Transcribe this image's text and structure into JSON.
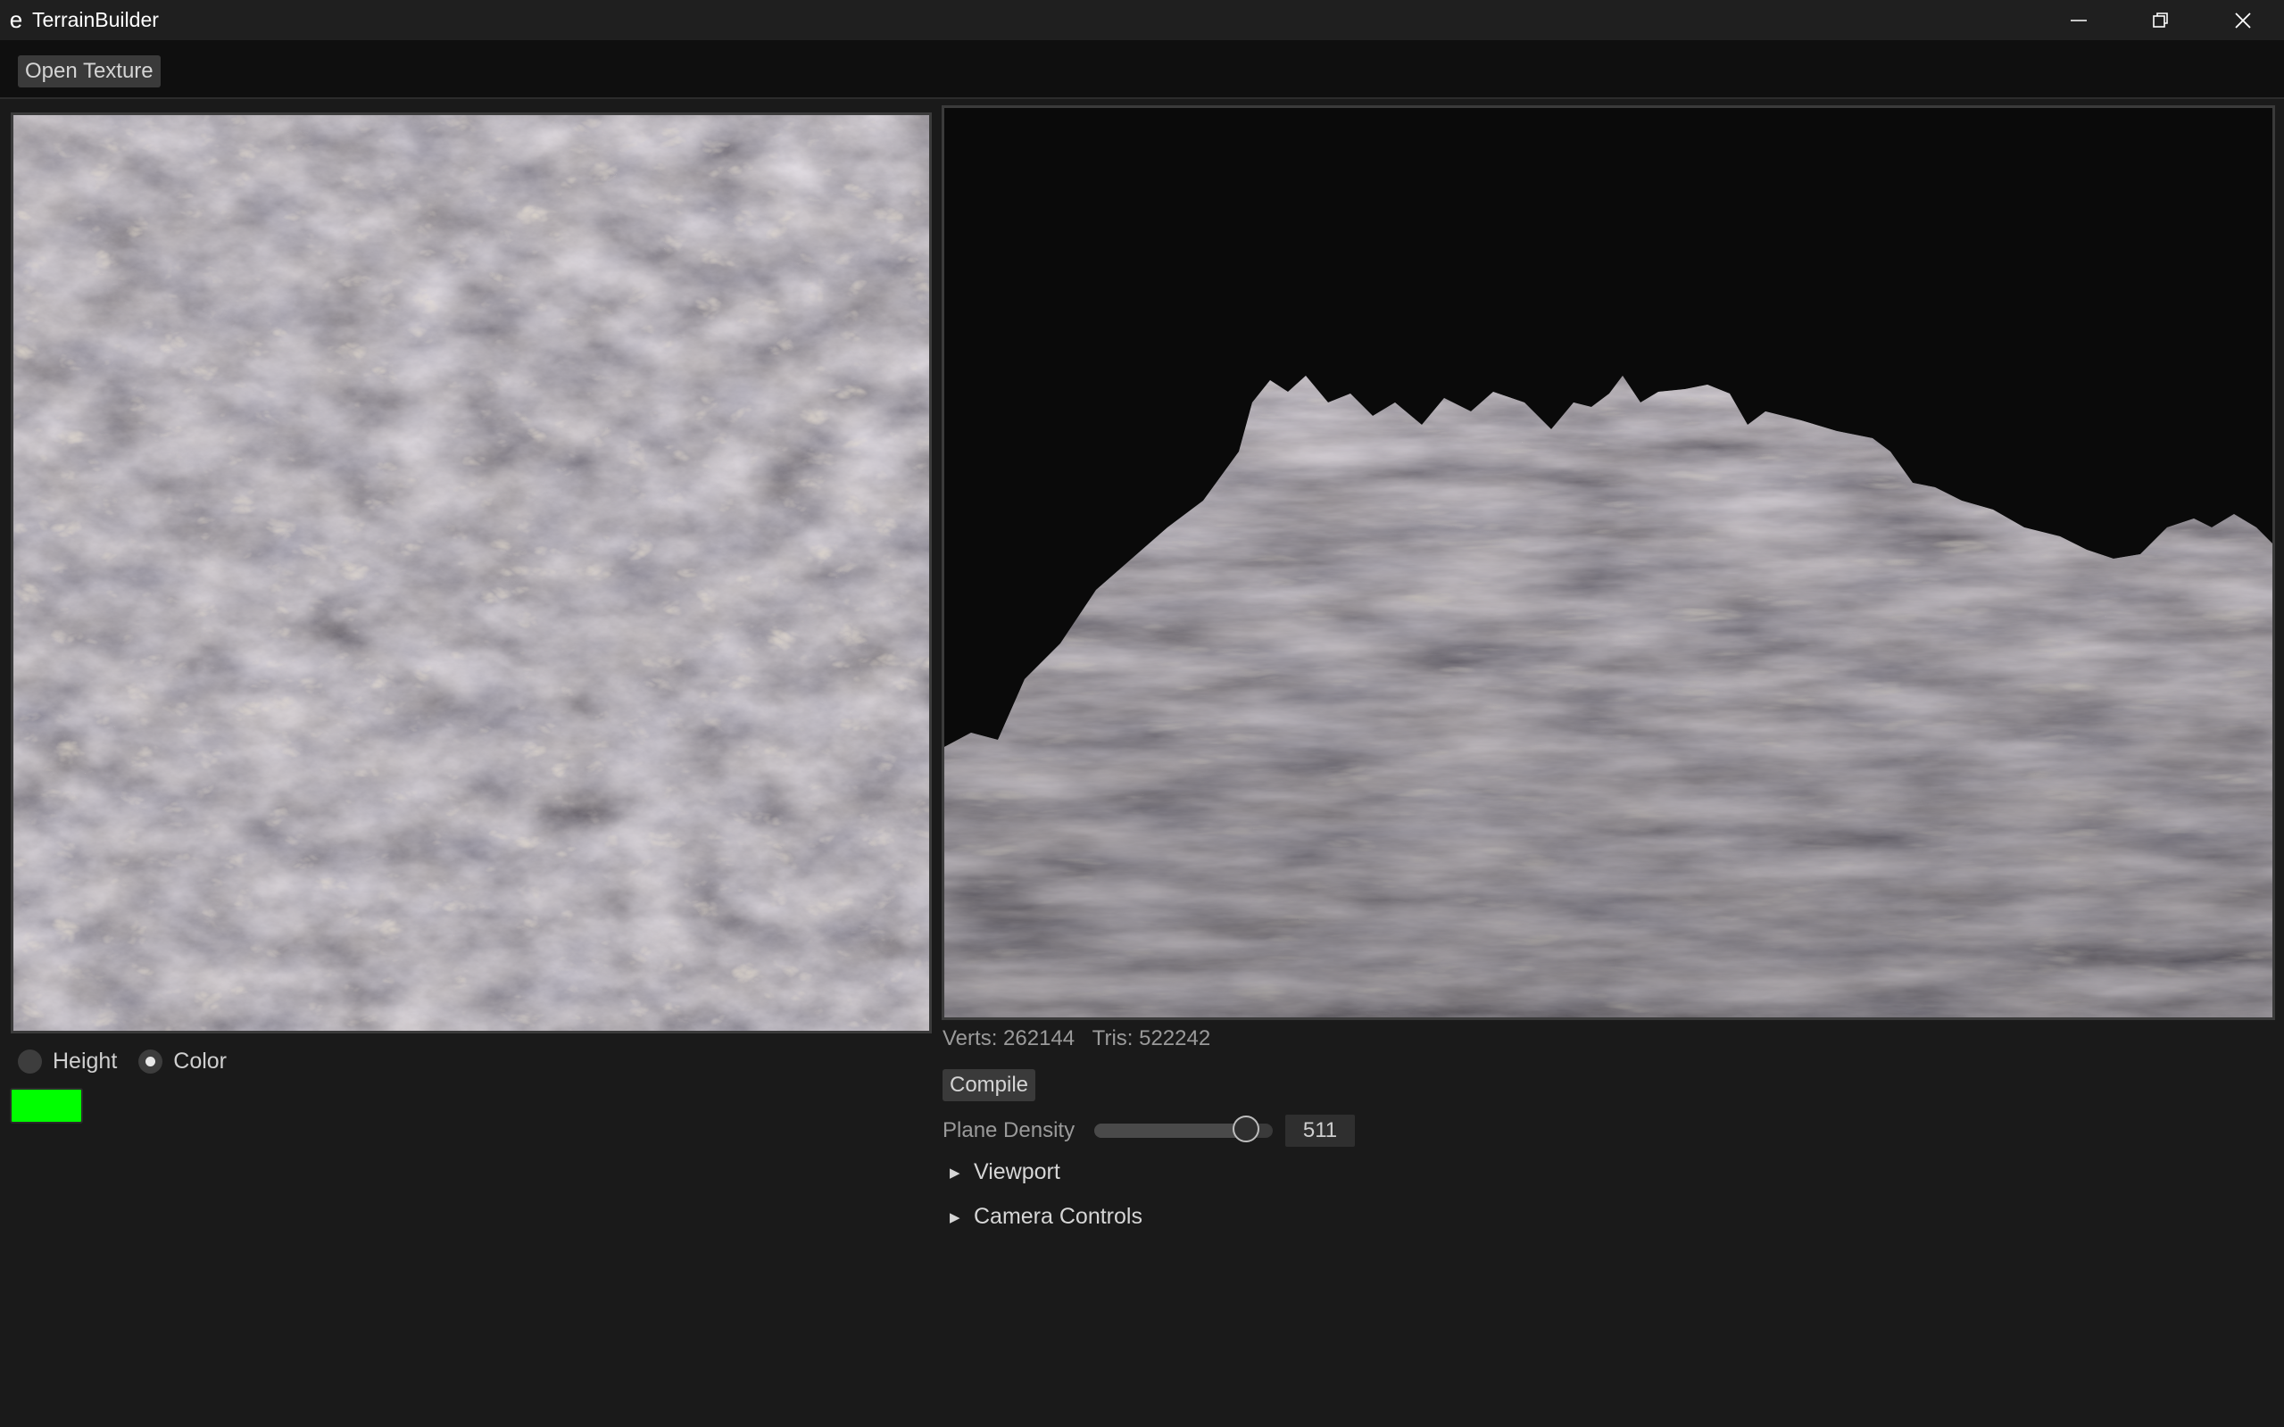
{
  "window": {
    "app_icon": "e",
    "title": "TerrainBuilder",
    "controls": [
      "minimize-icon",
      "restore-icon",
      "close-icon"
    ]
  },
  "toolbar": {
    "open_texture_label": "Open Texture"
  },
  "texture_panel": {
    "modes": [
      {
        "label": "Height",
        "selected": false
      },
      {
        "label": "Color",
        "selected": true
      }
    ],
    "swatch_color": "#00ff00"
  },
  "viewport_panel": {
    "stats": "Verts: 262144   Tris: 522242",
    "compile_label": "Compile",
    "density": {
      "label": "Plane Density",
      "value": "511",
      "fraction": 0.85
    },
    "sections": [
      {
        "label": "Viewport",
        "expanded": false
      },
      {
        "label": "Camera Controls",
        "expanded": false
      }
    ]
  },
  "colors": {
    "background": "#1a1a1a",
    "toolbar": "#0f0f0f",
    "viewport_bg": "#0a0a0a",
    "accent_swatch": "#00ff00"
  }
}
